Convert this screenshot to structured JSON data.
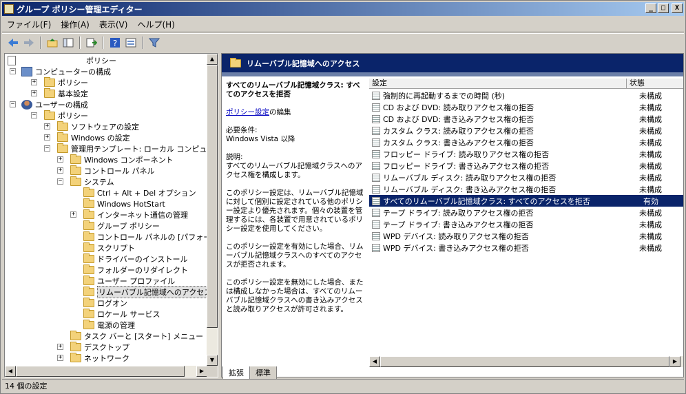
{
  "window": {
    "title": "グループ ポリシー管理エディター",
    "min": "_",
    "max": "□",
    "close": "X"
  },
  "menu": [
    "ファイル(F)",
    "操作(A)",
    "表示(V)",
    "ヘルプ(H)"
  ],
  "toolbar_icons": [
    "back-arrow-icon",
    "forward-arrow-icon",
    "up-folder-icon",
    "show-tree-icon",
    "export-icon",
    "help-icon",
    "properties-icon",
    "filter-icon"
  ],
  "tree": [
    {
      "label": "ポリシー",
      "level": 0,
      "expander": "",
      "icon": "doc"
    },
    {
      "label": "コンピューターの構成",
      "level": 0,
      "expander": "−",
      "icon": "computer"
    },
    {
      "label": "ポリシー",
      "level": 1,
      "expander": "+",
      "icon": "folder"
    },
    {
      "label": "基本設定",
      "level": 1,
      "expander": "+",
      "icon": "folder"
    },
    {
      "label": "ユーザーの構成",
      "level": 0,
      "expander": "−",
      "icon": "user"
    },
    {
      "label": "ポリシー",
      "level": 1,
      "expander": "−",
      "icon": "folder"
    },
    {
      "label": "ソフトウェアの設定",
      "level": 2,
      "expander": "+",
      "icon": "folder"
    },
    {
      "label": "Windows の設定",
      "level": 2,
      "expander": "+",
      "icon": "folder"
    },
    {
      "label": "管理用テンプレート: ローカル コンピューターか",
      "level": 2,
      "expander": "−",
      "icon": "folder"
    },
    {
      "label": "Windows コンポーネント",
      "level": 3,
      "expander": "+",
      "icon": "folder"
    },
    {
      "label": "コントロール パネル",
      "level": 3,
      "expander": "+",
      "icon": "folder"
    },
    {
      "label": "システム",
      "level": 3,
      "expander": "−",
      "icon": "folder"
    },
    {
      "label": "Ctrl + Alt + Del オプション",
      "level": 4,
      "expander": "",
      "icon": "folder"
    },
    {
      "label": "Windows HotStart",
      "level": 4,
      "expander": "",
      "icon": "folder"
    },
    {
      "label": "インターネット通信の管理",
      "level": 4,
      "expander": "+",
      "icon": "folder"
    },
    {
      "label": "グループ ポリシー",
      "level": 4,
      "expander": "",
      "icon": "folder"
    },
    {
      "label": "コントロール パネルの [パフォーマンス]",
      "level": 4,
      "expander": "",
      "icon": "folder"
    },
    {
      "label": "スクリプト",
      "level": 4,
      "expander": "",
      "icon": "folder"
    },
    {
      "label": "ドライバーのインストール",
      "level": 4,
      "expander": "",
      "icon": "folder"
    },
    {
      "label": "フォルダーのリダイレクト",
      "level": 4,
      "expander": "",
      "icon": "folder"
    },
    {
      "label": "ユーザー プロファイル",
      "level": 4,
      "expander": "",
      "icon": "folder"
    },
    {
      "label": "リムーバブル記憶域へのアクセス",
      "level": 4,
      "expander": "",
      "icon": "folder",
      "selected": true
    },
    {
      "label": "ログオン",
      "level": 4,
      "expander": "",
      "icon": "folder"
    },
    {
      "label": "ロケール サービス",
      "level": 4,
      "expander": "",
      "icon": "folder"
    },
    {
      "label": "電源の管理",
      "level": 4,
      "expander": "",
      "icon": "folder"
    },
    {
      "label": "タスク バーと [スタート] メニュー",
      "level": 3,
      "expander": "",
      "icon": "folder"
    },
    {
      "label": "デスクトップ",
      "level": 3,
      "expander": "+",
      "icon": "folder"
    },
    {
      "label": "ネットワーク",
      "level": 3,
      "expander": "+",
      "icon": "folder"
    }
  ],
  "right": {
    "header": "リムーバブル記憶域へのアクセス",
    "desc_title": "すべてのリムーバブル記憶域クラス: すべてのアクセスを拒否",
    "edit_link": "ポリシー設定",
    "edit_suffix": "の編集",
    "requirements": "必要条件:\nWindows Vista 以降",
    "description": "説明:\nすべてのリムーバブル記憶域クラスへのアクセス権を構成します。",
    "p1": "このポリシー設定は、リムーバブル記憶域に対して個別に設定されている他のポリシー設定より優先されます。個々の装置を管理するには、各装置で用意されているポリシー設定を使用してください。",
    "p2": "このポリシー設定を有効にした場合、リムーバブル記憶域クラスへのすべてのアクセスが拒否されます。",
    "p3": "このポリシー設定を無効にした場合、または構成しなかった場合は、すべてのリムーバブル記憶域クラスへの書き込みアクセスと読み取りアクセスが許可されます。",
    "col_setting": "設定",
    "col_state": "状態",
    "rows": [
      {
        "name": "強制的に再起動するまでの時間 (秒)",
        "state": "未構成"
      },
      {
        "name": "CD および DVD: 読み取りアクセス権の拒否",
        "state": "未構成"
      },
      {
        "name": "CD および DVD: 書き込みアクセス権の拒否",
        "state": "未構成"
      },
      {
        "name": "カスタム クラス: 読み取りアクセス権の拒否",
        "state": "未構成"
      },
      {
        "name": "カスタム クラス: 書き込みアクセス権の拒否",
        "state": "未構成"
      },
      {
        "name": "フロッピー ドライブ: 読み取りアクセス権の拒否",
        "state": "未構成"
      },
      {
        "name": "フロッピー ドライブ: 書き込みアクセス権の拒否",
        "state": "未構成"
      },
      {
        "name": "リムーバブル ディスク: 読み取りアクセス権の拒否",
        "state": "未構成"
      },
      {
        "name": "リムーバブル ディスク: 書き込みアクセス権の拒否",
        "state": "未構成"
      },
      {
        "name": "すべてのリムーバブル記憶域クラス: すべてのアクセスを拒否",
        "state": "有効",
        "selected": true
      },
      {
        "name": "テープ ドライブ: 読み取りアクセス権の拒否",
        "state": "未構成"
      },
      {
        "name": "テープ ドライブ: 書き込みアクセス権の拒否",
        "state": "未構成"
      },
      {
        "name": "WPD デバイス: 読み取りアクセス権の拒否",
        "state": "未構成"
      },
      {
        "name": "WPD デバイス: 書き込みアクセス権の拒否",
        "state": "未構成"
      }
    ],
    "tabs": [
      "拡張",
      "標準"
    ]
  },
  "status": "14 個の設定"
}
